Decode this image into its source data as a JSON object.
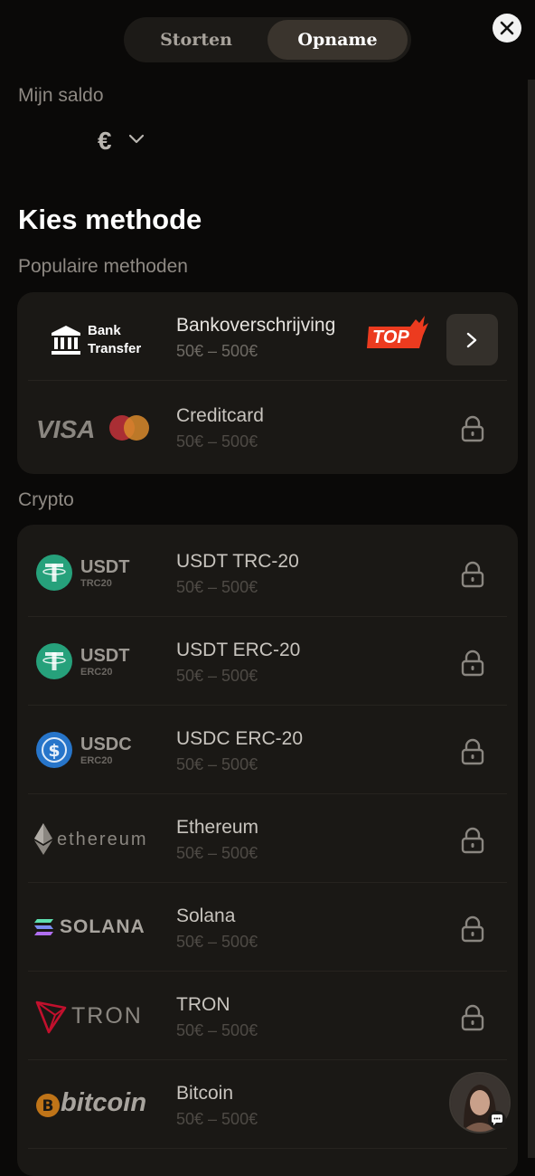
{
  "tabs": {
    "deposit": "Storten",
    "withdraw": "Opname",
    "active": "withdraw"
  },
  "balance": {
    "label": "Mijn saldo",
    "currency_symbol": "€"
  },
  "heading": "Kies methode",
  "popular": {
    "label": "Populaire methoden",
    "items": [
      {
        "logo_text_1": "Bank",
        "logo_text_2": "Transfer",
        "name": "Bankoverschrijving",
        "range": "50€ – 500€",
        "badge": "TOP",
        "status": "available"
      },
      {
        "logo_text": "VISA",
        "name": "Creditcard",
        "range": "50€ – 500€",
        "status": "locked"
      }
    ]
  },
  "crypto": {
    "label": "Crypto",
    "items": [
      {
        "logo_text": "USDT",
        "logo_sub": "TRC20",
        "name": "USDT TRC-20",
        "range": "50€ – 500€",
        "status": "locked"
      },
      {
        "logo_text": "USDT",
        "logo_sub": "ERC20",
        "name": "USDT ERC-20",
        "range": "50€ – 500€",
        "status": "locked"
      },
      {
        "logo_text": "USDC",
        "logo_sub": "ERC20",
        "name": "USDC ERC-20",
        "range": "50€ – 500€",
        "status": "locked"
      },
      {
        "logo_text": "ethereum",
        "name": "Ethereum",
        "range": "50€ – 500€",
        "status": "locked"
      },
      {
        "logo_text": "SOLANA",
        "name": "Solana",
        "range": "50€ – 500€",
        "status": "locked"
      },
      {
        "logo_text": "TRON",
        "name": "TRON",
        "range": "50€ – 500€",
        "status": "locked"
      },
      {
        "logo_text": "bitcoin",
        "name": "Bitcoin",
        "range": "50€ – 500€",
        "status": "locked"
      }
    ]
  },
  "colors": {
    "top_badge": "#ec3b1f",
    "tether": "#26a17b",
    "usdc": "#2775ca",
    "bitcoin": "#f7931a",
    "tron": "#c2102d",
    "background": "#0a0908",
    "card": "#1a1815"
  },
  "icons": {
    "close": "close-icon",
    "chevron": "chevron-down-icon",
    "arrow": "chevron-right-icon",
    "lock": "lock-icon",
    "chat": "chat-icon"
  }
}
